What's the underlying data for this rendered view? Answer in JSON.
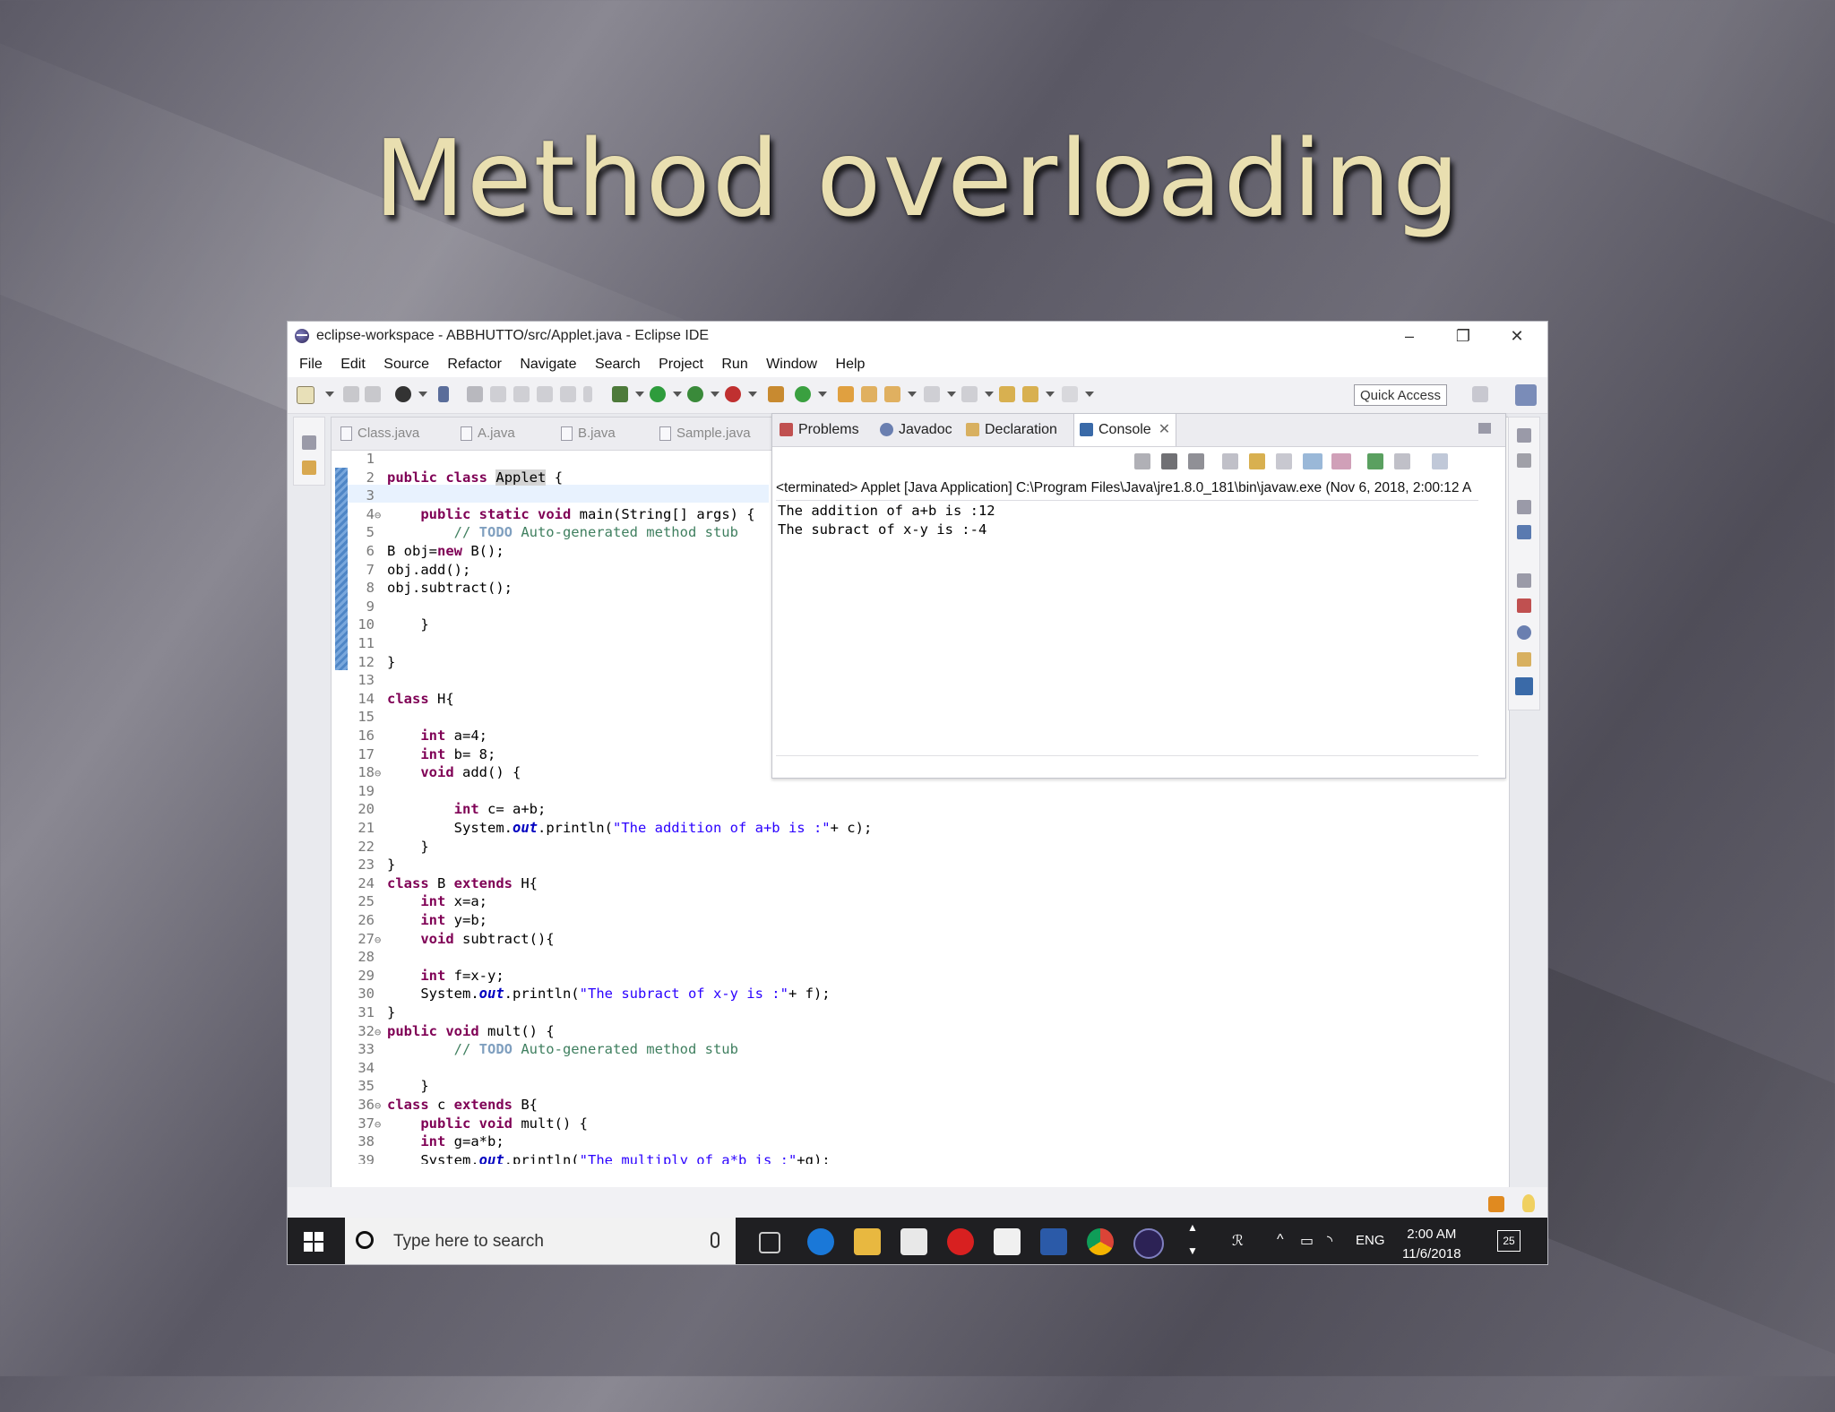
{
  "slide": {
    "title": "Method overloading"
  },
  "window": {
    "title": "eclipse-workspace - ABBHUTTO/src/Applet.java - Eclipse IDE",
    "minimize": "–",
    "maximize": "❐",
    "close": "✕"
  },
  "menu": [
    "File",
    "Edit",
    "Source",
    "Refactor",
    "Navigate",
    "Search",
    "Project",
    "Run",
    "Window",
    "Help"
  ],
  "toolbar": {
    "quick_access": "Quick Access"
  },
  "editor_tabs": [
    "Class.java",
    "A.java",
    "B.java",
    "Sample.java"
  ],
  "code_lines": [
    {
      "n": "1",
      "html": ""
    },
    {
      "n": "2",
      "html": "<span class='kw'>public</span> <span class='kw'>class</span> <span class='occur'>Applet</span> {"
    },
    {
      "n": "3",
      "html": ""
    },
    {
      "n": "4",
      "fold": true,
      "html": "    <span class='kw'>public</span> <span class='kw'>static</span> <span class='kw'>void</span> main(String[] args) {"
    },
    {
      "n": "5",
      "html": "        <span class='cm'>// <span class='todo'>TODO</span> Auto-generated method stub</span>"
    },
    {
      "n": "6",
      "html": "B obj=<span class='kw'>new</span> B();"
    },
    {
      "n": "7",
      "html": "obj.add();"
    },
    {
      "n": "8",
      "html": "obj.subtract();"
    },
    {
      "n": "9",
      "html": ""
    },
    {
      "n": "10",
      "html": "    }"
    },
    {
      "n": "11",
      "html": ""
    },
    {
      "n": "12",
      "html": "}"
    },
    {
      "n": "13",
      "html": ""
    },
    {
      "n": "14",
      "html": "<span class='kw'>class</span> H{"
    },
    {
      "n": "15",
      "html": ""
    },
    {
      "n": "16",
      "html": "    <span class='kw'>int</span> a=4;"
    },
    {
      "n": "17",
      "html": "    <span class='kw'>int</span> b= 8;"
    },
    {
      "n": "18",
      "fold": true,
      "html": "    <span class='kw'>void</span> add() {"
    },
    {
      "n": "19",
      "html": ""
    },
    {
      "n": "20",
      "html": "        <span class='kw'>int</span> c= a+b;"
    },
    {
      "n": "21",
      "html": "        System.<span class='fld'>out</span>.println(<span class='st'>\"The addition of a+b is :\"</span>+ c);"
    },
    {
      "n": "22",
      "html": "    }"
    },
    {
      "n": "23",
      "html": "}"
    },
    {
      "n": "24",
      "html": "<span class='kw'>class</span> B <span class='kw'>extends</span> H{"
    },
    {
      "n": "25",
      "html": "    <span class='kw'>int</span> x=a;"
    },
    {
      "n": "26",
      "html": "    <span class='kw'>int</span> y=b;"
    },
    {
      "n": "27",
      "fold": true,
      "html": "    <span class='kw'>void</span> subtract(){"
    },
    {
      "n": "28",
      "html": ""
    },
    {
      "n": "29",
      "html": "    <span class='kw'>int</span> f=x-y;"
    },
    {
      "n": "30",
      "html": "    System.<span class='fld'>out</span>.println(<span class='st'>\"The subract of x-y is :\"</span>+ f);"
    },
    {
      "n": "31",
      "html": "}"
    },
    {
      "n": "32",
      "fold": true,
      "html": "<span class='kw'>public</span> <span class='kw'>void</span> mult() {"
    },
    {
      "n": "33",
      "html": "        <span class='cm'>// <span class='todo'>TODO</span> Auto-generated method stub</span>"
    },
    {
      "n": "34",
      "html": ""
    },
    {
      "n": "35",
      "html": "    }"
    },
    {
      "n": "36",
      "fold": true,
      "html": "<span class='kw'>class</span> c <span class='kw'>extends</span> B{"
    },
    {
      "n": "37",
      "fold": true,
      "html": "    <span class='kw'>public</span> <span class='kw'>void</span> mult() {"
    },
    {
      "n": "38",
      "html": "    <span class='kw'>int</span> g=a*b;"
    },
    {
      "n": "39",
      "html": "    System.<span class='fld'>out</span>.println(<span class='st'>\"The multiply of a*b is :\"</span>+g);"
    }
  ],
  "console": {
    "tabs": [
      "Problems",
      "Javadoc",
      "Declaration",
      "Console"
    ],
    "header": "<terminated> Applet [Java Application] C:\\Program Files\\Java\\jre1.8.0_181\\bin\\javaw.exe (Nov 6, 2018, 2:00:12 A",
    "output": [
      "The addition of a+b is :12",
      "The subract of x-y is :-4"
    ]
  },
  "taskbar": {
    "search_placeholder": "Type here to search",
    "language": "ENG",
    "time": "2:00 AM",
    "date": "11/6/2018",
    "notifications": "25"
  },
  "colors": {
    "keyword": "#7f0055",
    "comment": "#3f7f5f",
    "string": "#2a00ff",
    "title_gold": "#e9dfb0"
  }
}
